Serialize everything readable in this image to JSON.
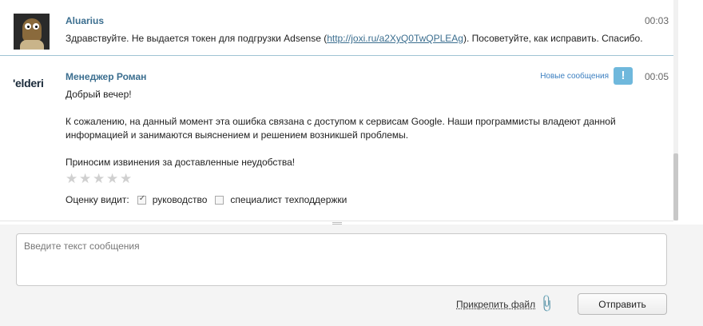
{
  "messages": [
    {
      "author": "Aluarius",
      "time": "00:03",
      "text_before": "Здравствуйте. Не выдается токен для подгрузки Adsense (",
      "link": "http://joxi.ru/a2XyQ0TwQPLEAg",
      "text_after": "). Посоветуйте, как исправить. Спасибо."
    },
    {
      "author": "Менеджер Роман",
      "avatar_logo": "elderi",
      "time": "00:05",
      "new_messages_label": "Новые сообщения",
      "alert_glyph": "!",
      "greeting": "Добрый вечер!",
      "paragraph1": "К сожалению, на данный момент эта ошибка связана с доступом к сервисам Google. Наши программисты владеют данной информацией и занимаются выяснением и решением возникшей проблемы.",
      "paragraph2": "Приносим извинения за доставленные неудобства!",
      "rating": {
        "stars": 5,
        "selected": 0,
        "icon": "star-icon"
      },
      "visibility": {
        "label": "Оценку видит:",
        "options": [
          {
            "label": "руководство",
            "checked": true
          },
          {
            "label": "специалист техподдержки",
            "checked": false
          }
        ]
      }
    }
  ],
  "composer": {
    "placeholder": "Введите текст сообщения",
    "attach_label": "Прикрепить файл",
    "attach_icon": "paperclip-icon",
    "send_label": "Отправить"
  },
  "colors": {
    "author": "#3b6e8f",
    "link": "#3b6e8f",
    "new_label": "#3b7fc0",
    "alert_bg": "#6fb8dc",
    "composer_bg": "#f4f4f4"
  }
}
